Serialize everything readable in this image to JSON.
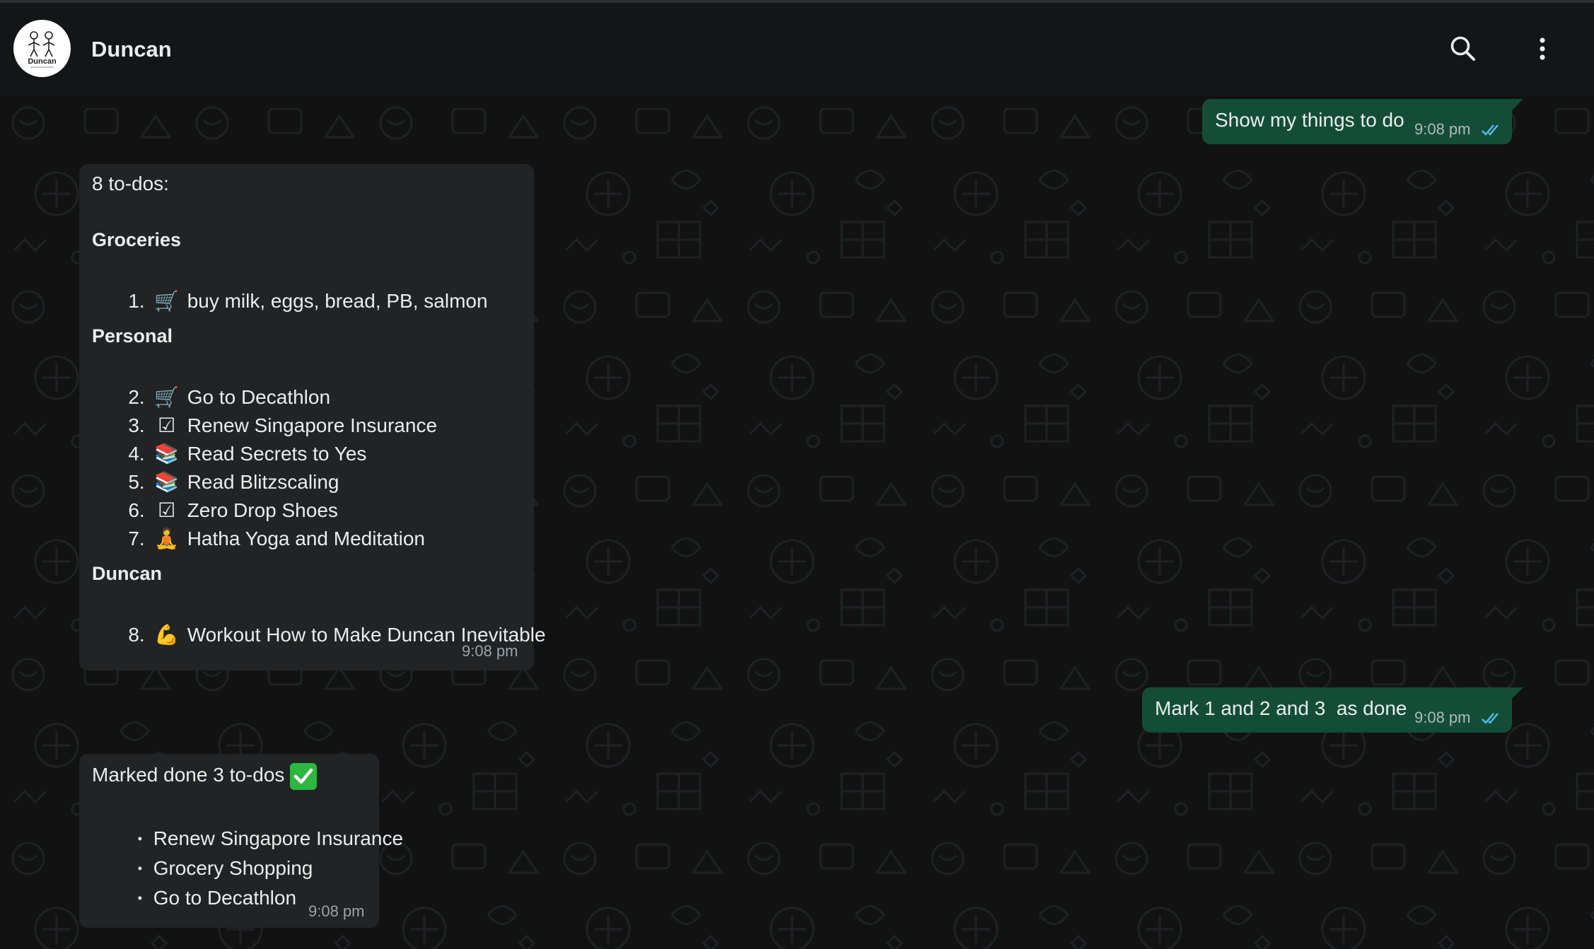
{
  "header": {
    "contact_name": "Duncan",
    "avatar_caption": "Duncan",
    "icons": [
      "search-icon",
      "more-vertical-icon"
    ]
  },
  "messages": {
    "m1": {
      "direction": "outgoing",
      "text": "Show my things to do",
      "time": "9:08 pm",
      "status": "read"
    },
    "m2": {
      "direction": "incoming",
      "intro": "8 to-dos:",
      "sections": [
        {
          "title": "Groceries",
          "items": [
            {
              "num": "1.",
              "icon": "🛒",
              "icon_name": "shopping-cart-icon",
              "text": "buy milk, eggs, bread, PB, salmon"
            }
          ]
        },
        {
          "title": "Personal",
          "items": [
            {
              "num": "2.",
              "icon": "🛒",
              "icon_name": "shopping-cart-icon",
              "text": "Go to Decathlon"
            },
            {
              "num": "3.",
              "icon": "☑",
              "icon_name": "check-box-icon",
              "text": "Renew Singapore Insurance"
            },
            {
              "num": "4.",
              "icon": "📚",
              "icon_name": "books-icon",
              "text": "Read Secrets to Yes"
            },
            {
              "num": "5.",
              "icon": "📚",
              "icon_name": "books-icon",
              "text": "Read Blitzscaling"
            },
            {
              "num": "6.",
              "icon": "☑",
              "icon_name": "check-box-icon",
              "text": "Zero Drop Shoes"
            },
            {
              "num": "7.",
              "icon": "🧘",
              "icon_name": "meditation-icon",
              "text": "Hatha Yoga and Meditation"
            }
          ]
        },
        {
          "title": "Duncan",
          "items": [
            {
              "num": "8.",
              "icon": "💪",
              "icon_name": "flexed-biceps-icon",
              "text": "Workout How to Make Duncan Inevitable"
            }
          ]
        }
      ],
      "time": "9:08 pm"
    },
    "m3": {
      "direction": "outgoing",
      "text": "Mark 1 and 2 and 3  as done",
      "time": "9:08 pm",
      "status": "read"
    },
    "m4": {
      "direction": "incoming",
      "intro": "Marked done 3 to-dos",
      "intro_icon": "green-check-icon",
      "bullets": [
        "Renew Singapore Insurance",
        "Grocery Shopping",
        "Go to Decathlon"
      ],
      "time": "9:08 pm"
    }
  },
  "colors": {
    "header_bg": "#131617",
    "chat_bg": "#121212",
    "outgoing_bubble": "#144d37",
    "incoming_bubble": "#212324",
    "read_ticks": "#53bdeb",
    "text": "#e9edef"
  }
}
